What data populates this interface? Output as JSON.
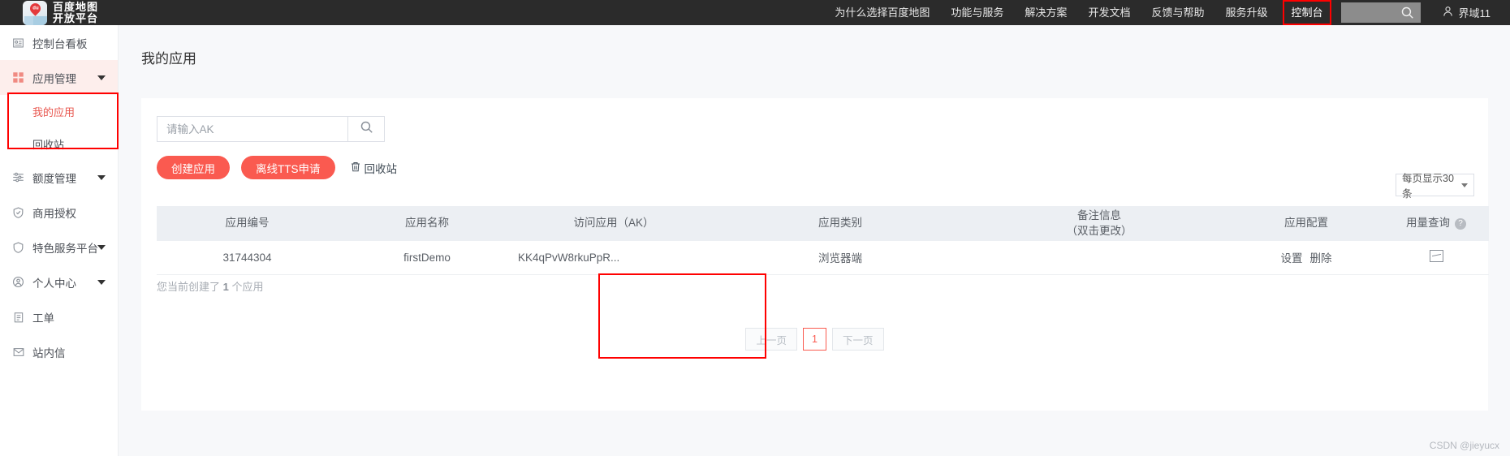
{
  "topnav": {
    "logo": {
      "badge": "du",
      "line1": "百度地图",
      "line2": "开放平台"
    },
    "items": [
      {
        "label": "为什么选择百度地图",
        "highlighted": false
      },
      {
        "label": "功能与服务",
        "highlighted": false
      },
      {
        "label": "解决方案",
        "highlighted": false
      },
      {
        "label": "开发文档",
        "highlighted": false
      },
      {
        "label": "反馈与帮助",
        "highlighted": false
      },
      {
        "label": "服务升级",
        "highlighted": false
      },
      {
        "label": "控制台",
        "highlighted": true
      }
    ],
    "search_icon": "search-icon",
    "user": {
      "icon": "user-icon",
      "name": "界域11"
    }
  },
  "sidebar": {
    "items": [
      {
        "label": "控制台看板",
        "icon": "dashboard-icon",
        "caret": false,
        "level": "top"
      },
      {
        "label": "应用管理",
        "icon": "apps-grid-icon",
        "caret": true,
        "level": "top",
        "state": "active-group"
      },
      {
        "label": "我的应用",
        "icon": "",
        "caret": false,
        "level": "sub",
        "state": "current"
      },
      {
        "label": "回收站",
        "icon": "",
        "caret": false,
        "level": "sub"
      },
      {
        "label": "额度管理",
        "icon": "sliders-icon",
        "caret": true,
        "level": "top"
      },
      {
        "label": "商用授权",
        "icon": "shield-check-icon",
        "caret": false,
        "level": "top"
      },
      {
        "label": "特色服务平台",
        "icon": "shield-icon",
        "caret": true,
        "level": "top"
      },
      {
        "label": "个人中心",
        "icon": "person-circle-icon",
        "caret": true,
        "level": "top"
      },
      {
        "label": "工单",
        "icon": "clipboard-icon",
        "caret": false,
        "level": "top"
      },
      {
        "label": "站内信",
        "icon": "mail-icon",
        "caret": false,
        "level": "top"
      }
    ]
  },
  "main": {
    "page_title": "我的应用",
    "search": {
      "placeholder": "请输入AK",
      "value": "",
      "icon": "search-icon"
    },
    "buttons": {
      "create": "创建应用",
      "tts": "离线TTS申请",
      "recycle": "回收站",
      "recycle_icon": "trash-icon"
    },
    "per_page": {
      "label": "每页显示30条",
      "icon": "chevron-down-icon"
    },
    "table": {
      "headers": [
        {
          "label": "应用编号"
        },
        {
          "label": "应用名称"
        },
        {
          "label": "访问应用（AK）"
        },
        {
          "label": "应用类别"
        },
        {
          "label": "备注信息",
          "sub": "（双击更改）"
        },
        {
          "label": "应用配置"
        },
        {
          "label": "用量查询",
          "help": "?"
        }
      ],
      "rows": [
        {
          "id": "31744304",
          "name": "firstDemo",
          "ak": "KK4qPvW8rkuPpR...",
          "category": "浏览器端",
          "note": "",
          "config_actions": [
            "设置",
            "删除"
          ],
          "usage_icon": "chart-icon"
        }
      ]
    },
    "count_prefix": "您当前创建了",
    "count_value": "1",
    "count_suffix": "个应用",
    "pagination": {
      "prev": "上一页",
      "current": "1",
      "next": "下一页"
    }
  },
  "watermark": "CSDN @jieyucx",
  "colors": {
    "accent": "#fa5a50",
    "topnav_bg": "#2b2b2b",
    "annotation": "#ff0000",
    "page_bg": "#f7f8fa"
  }
}
